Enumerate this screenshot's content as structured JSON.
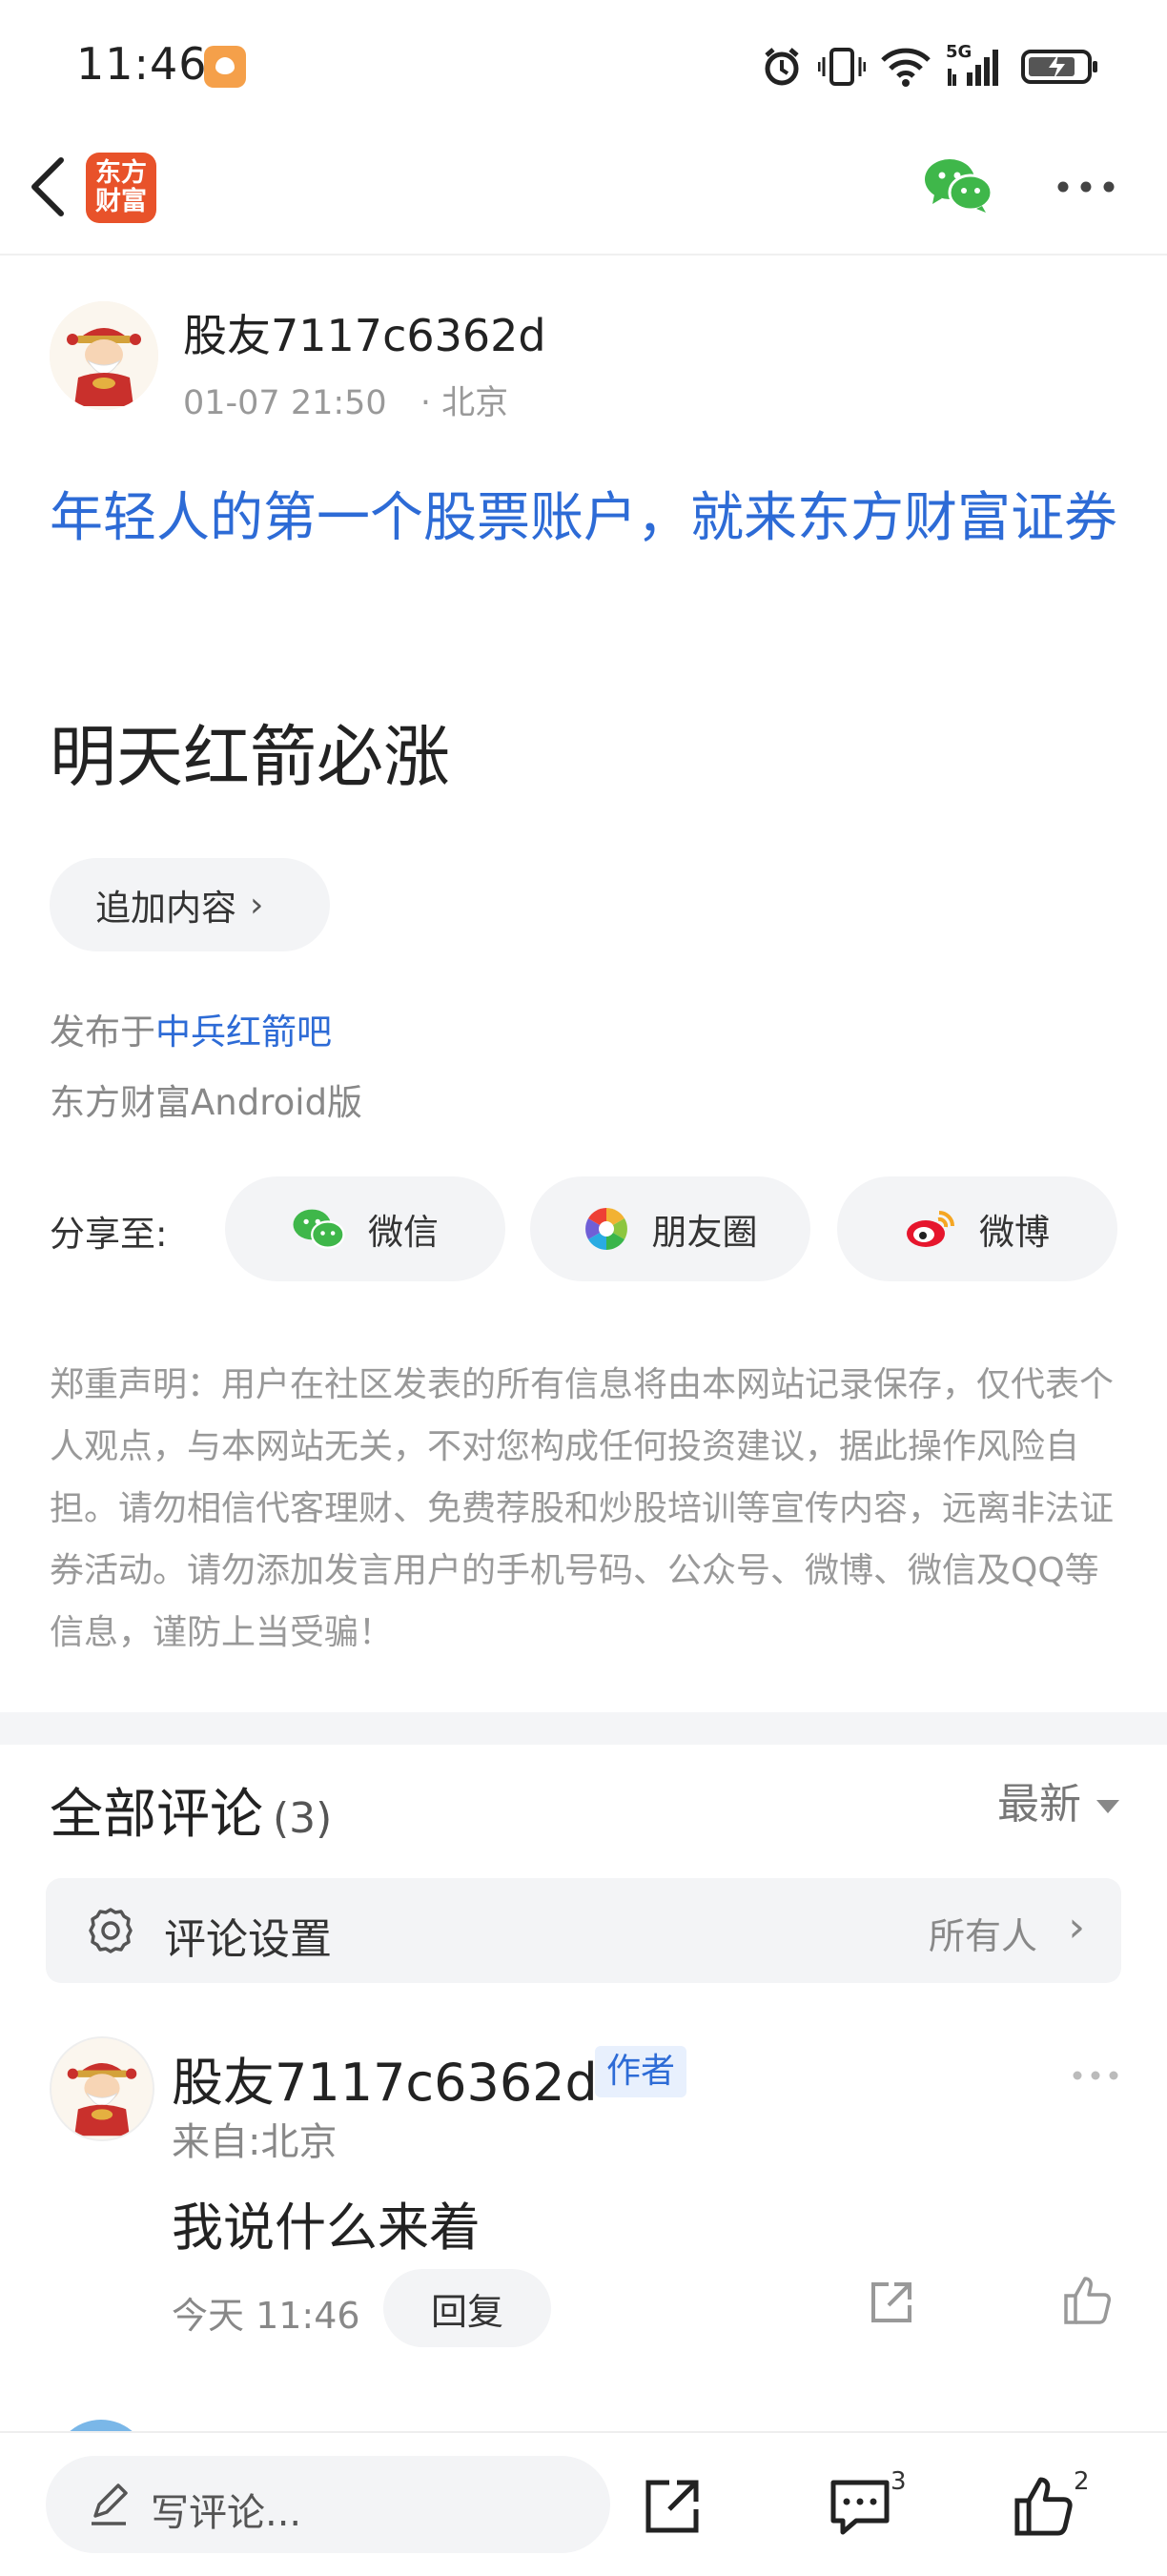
{
  "status_bar": {
    "time": "11:46",
    "network": "5G"
  },
  "header": {
    "logo_line1": "东方",
    "logo_line2": "财富"
  },
  "post": {
    "author": "股友7117c6362d",
    "time": "01-07 21:50",
    "location": "· 北京",
    "headline": "年轻人的第一个股票账户，就来东方财富证券",
    "content": "明天红箭必涨",
    "append_label": "追加内容",
    "published_prefix": "发布于",
    "published_bar": "中兵红箭吧",
    "source": "东方财富Android版"
  },
  "share": {
    "label": "分享至:",
    "wechat": "微信",
    "moments": "朋友圈",
    "weibo": "微博"
  },
  "disclaimer": "郑重声明：用户在社区发表的所有信息将由本网站记录保存，仅代表个人观点，与本网站无关，不对您构成任何投资建议，据此操作风险自担。请勿相信代客理财、免费荐股和炒股培训等宣传内容，远离非法证券活动。请勿添加发言用户的手机号码、公众号、微博、微信及QQ等信息，谨防上当受骗！",
  "comments": {
    "title": "全部评论",
    "count": "(3)",
    "sort": "最新",
    "settings_label": "评论设置",
    "settings_value": "所有人",
    "items": [
      {
        "author": "股友7117c6362d",
        "tag": "作者",
        "from": "来自:北京",
        "text": "我说什么来着",
        "time": "今天 11:46",
        "reply": "回复"
      }
    ]
  },
  "bottom_bar": {
    "write_placeholder": "写评论...",
    "comment_count": "3",
    "like_count": "2"
  },
  "colors": {
    "link_blue": "#2d6bd6",
    "brand_orange": "#e8522a",
    "wechat_green": "#3fb74a"
  }
}
